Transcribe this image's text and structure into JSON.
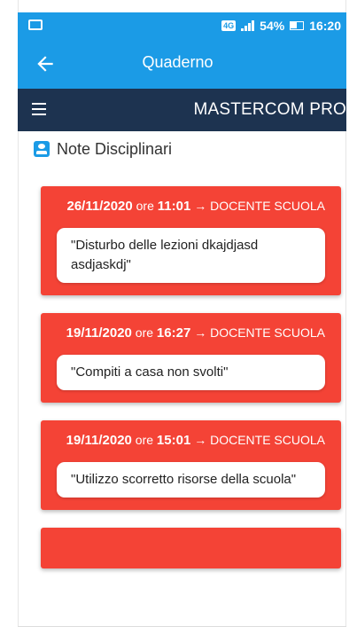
{
  "status_bar": {
    "network_badge": "4G",
    "battery_percent": "54%",
    "time": "16:20"
  },
  "app_bar": {
    "title": "Quaderno",
    "back_icon": "arrow-left-icon"
  },
  "menu_bar": {
    "brand": "MASTERCOM PRO",
    "menu_icon": "hamburger-icon"
  },
  "section": {
    "title": "Note Disciplinari",
    "icon": "contact-card-icon"
  },
  "notes": [
    {
      "date": "26/11/2020",
      "ore_label": "ore",
      "time": "11:01",
      "arrow": "→",
      "teacher": "DOCENTE SCUOLA",
      "text": "\"Disturbo delle lezioni dkajdjasd asdjaskdj\""
    },
    {
      "date": "19/11/2020",
      "ore_label": "ore",
      "time": "16:27",
      "arrow": "→",
      "teacher": "DOCENTE SCUOLA",
      "text": "\"Compiti a casa non svolti\""
    },
    {
      "date": "19/11/2020",
      "ore_label": "ore",
      "time": "15:01",
      "arrow": "→",
      "teacher": "DOCENTE SCUOLA",
      "text": "\"Utilizzo scorretto risorse della scuola\""
    }
  ],
  "colors": {
    "primary": "#1b9be6",
    "dark_nav": "#1d3350",
    "note_red": "#f44336"
  }
}
